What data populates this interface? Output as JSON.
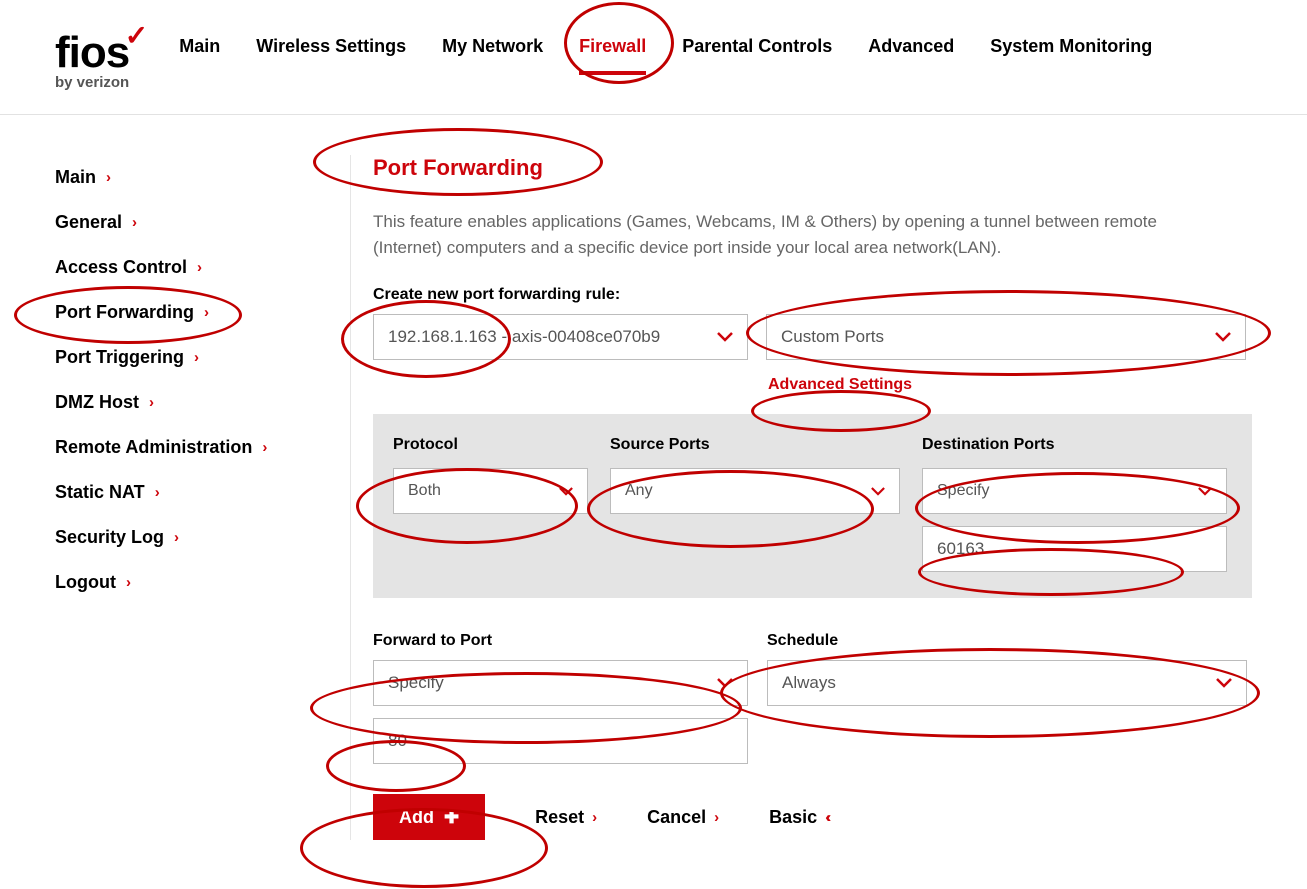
{
  "logo": {
    "text": "fios",
    "sub": "by verizon"
  },
  "topnav": [
    "Main",
    "Wireless Settings",
    "My Network",
    "Firewall",
    "Parental Controls",
    "Advanced",
    "System Monitoring"
  ],
  "topnav_active": "Firewall",
  "sidebar": [
    "Main",
    "General",
    "Access Control",
    "Port Forwarding",
    "Port Triggering",
    "DMZ Host",
    "Remote Administration",
    "Static NAT",
    "Security Log",
    "Logout"
  ],
  "page": {
    "title": "Port Forwarding",
    "description": "This feature enables applications (Games, Webcams, IM & Others) by opening a tunnel between remote (Internet) computers and a specific device port inside your local area network(LAN).",
    "create_label": "Create new port forwarding rule:",
    "device_select": "192.168.1.163 - axis-00408ce070b9",
    "app_select": "Custom Ports",
    "advanced_link": "Advanced Settings",
    "protocol_label": "Protocol",
    "protocol_value": "Both",
    "source_label": "Source Ports",
    "source_value": "Any",
    "dest_label": "Destination Ports",
    "dest_value": "Specify",
    "dest_port": "60163",
    "fwd_label": "Forward to Port",
    "fwd_value": "Specify",
    "fwd_port": "80",
    "sched_label": "Schedule",
    "sched_value": "Always",
    "btn_add": "Add",
    "btn_reset": "Reset",
    "btn_cancel": "Cancel",
    "btn_basic": "Basic"
  }
}
